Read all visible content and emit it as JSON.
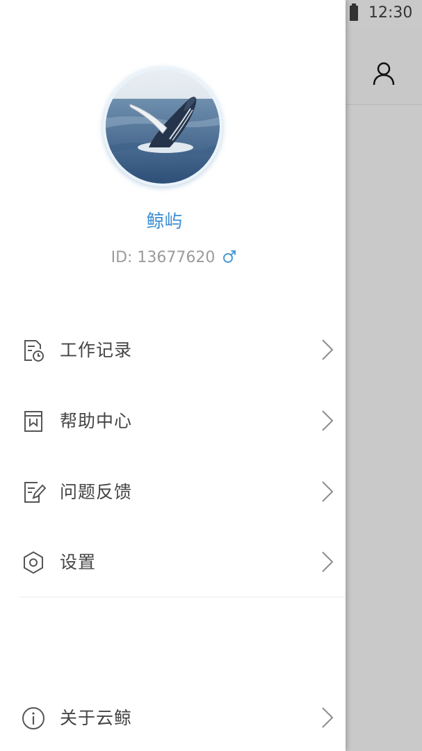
{
  "status_bar": {
    "time": "12:30",
    "battery_icon": "battery-full-icon"
  },
  "background_app": {
    "toolbar_icon": "person-icon"
  },
  "profile": {
    "avatar_image": "humpback-whale-breaching-photo",
    "name": "鲸屿",
    "id_text": "ID: 13677620",
    "gender_icon": "male-symbol-icon",
    "accent_color": "#3d8ed2"
  },
  "menu": {
    "items": [
      {
        "label": "工作记录",
        "icon": "work-record-icon"
      },
      {
        "label": "帮助中心",
        "icon": "help-book-icon"
      },
      {
        "label": "问题反馈",
        "icon": "feedback-edit-icon"
      },
      {
        "label": "设置",
        "icon": "settings-hexagon-icon"
      }
    ],
    "footer_item": {
      "label": "关于云鲸",
      "icon": "info-icon"
    }
  }
}
